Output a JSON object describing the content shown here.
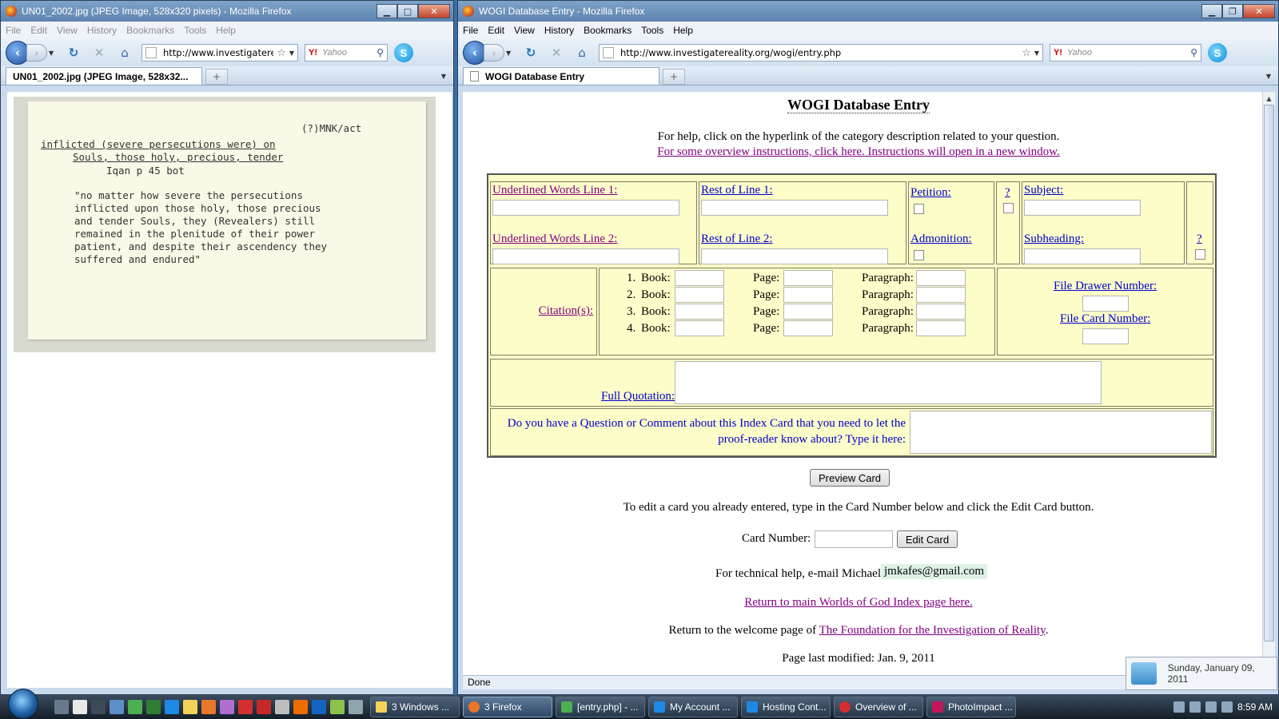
{
  "left_window": {
    "title": "UN01_2002.jpg (JPEG Image, 528x320 pixels) - Mozilla Firefox",
    "menu": [
      "File",
      "Edit",
      "View",
      "History",
      "Bookmarks",
      "Tools",
      "Help"
    ],
    "url": "http://www.investigatere",
    "search_placeholder": "Yahoo",
    "search_engine": "Y!",
    "tab_label": "UN01_2002.jpg (JPEG Image, 528x32...",
    "card": {
      "code": "(?)MNK/act",
      "line1": "inflicted (severe persecutions were) on",
      "line2": "Souls, those holy, precious, tender",
      "ref": "Iqan p 45 bot",
      "quote": [
        "\"no matter how severe the persecutions",
        "inflicted upon those holy, those precious",
        "and tender Souls, they (Revealers) still",
        "remained in the plenitude of their power",
        "patient, and despite their ascendency they",
        "suffered and endured\""
      ]
    }
  },
  "right_window": {
    "title": "WOGI Database Entry - Mozilla Firefox",
    "menu": [
      "File",
      "Edit",
      "View",
      "History",
      "Bookmarks",
      "Tools",
      "Help"
    ],
    "url": "http://www.investigatereality.org/wogi/entry.php",
    "search_placeholder": "Yahoo",
    "search_engine": "Y!",
    "tab_label": "WOGI Database Entry",
    "status": "Done"
  },
  "page": {
    "heading": "WOGI Database Entry",
    "help_text": "For help, click on the hyperlink of the category description related to your question.",
    "overview_link": "For some overview instructions, click here. Instructions will open in a new window.",
    "underlined_1": "Underlined Words Line 1:",
    "underlined_2": "Underlined Words Line 2:",
    "rest_1": "Rest of Line 1:",
    "rest_2": "Rest of Line 2:",
    "petition": "Petition:",
    "admonition": "Admonition:",
    "q_mark": "?",
    "subject": "Subject:",
    "subheading": "Subheading:",
    "citations": "Citation(s):",
    "citation_rows": [
      {
        "num": "1.",
        "book": "Book:",
        "page": "Page:",
        "paragraph": "Paragraph:"
      },
      {
        "num": "2.",
        "book": "Book:",
        "page": "Page:",
        "paragraph": "Paragraph:"
      },
      {
        "num": "3.",
        "book": "Book:",
        "page": "Page:",
        "paragraph": "Paragraph:"
      },
      {
        "num": "4.",
        "book": "Book:",
        "page": "Page:",
        "paragraph": "Paragraph:"
      }
    ],
    "file_drawer": "File Drawer Number:",
    "file_card": "File Card Number:",
    "full_quotation": "Full Quotation:",
    "question_line1": "Do you have a Question or Comment about this Index Card that you need to let the",
    "question_line2": "proof-reader know about? Type it here:",
    "preview_button": "Preview Card",
    "edit_instructions": "To edit a card you already entered, type in the Card Number below and click the Edit Card button.",
    "card_number_label": "Card Number:",
    "edit_button": "Edit Card",
    "tech_help": "For technical help, e-mail Michael:",
    "email": "jmkafes@gmail.com",
    "return_main": "Return to main Worlds of God Index page here.",
    "welcome_prefix": "Return to the welcome page of",
    "welcome_link": "The Foundation for the Investigation of Reality",
    "last_modified": "Page last modified: Jan. 9, 2011"
  },
  "clock_popup": "Sunday, January 09, 2011",
  "taskbar": {
    "buttons": [
      "3 Windows ...",
      "3 Firefox",
      "[entry.php] - ...",
      "My Account ...",
      "Hosting Cont...",
      "Overview of ...",
      "PhotoImpact ..."
    ],
    "time": "8:59 AM"
  },
  "colors": {
    "form_bg": "#fdfdc9",
    "link": "#0000cc",
    "visited": "#800080",
    "taskbar": "#1f2b38"
  }
}
